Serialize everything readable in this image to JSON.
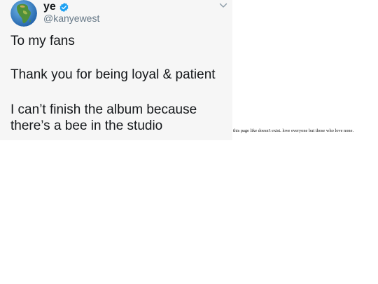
{
  "tweet": {
    "display_name": "ye",
    "handle": "@kanyewest",
    "avatar_icon": "globe-africa-icon",
    "verified_icon": "verified-badge-icon",
    "menu_icon": "chevron-down-icon",
    "lines": [
      "To my fans",
      "Thank you for being loyal & patient",
      "I can’t finish the album because",
      "there’s a bee in the studio"
    ],
    "colors": {
      "verified": "#1da1f2",
      "text": "#14171a",
      "handle": "#657786",
      "card_background": "#f6f6f6"
    }
  },
  "side_note": {
    "text": "this page like doesn't exist. love everyone but those who love none."
  }
}
